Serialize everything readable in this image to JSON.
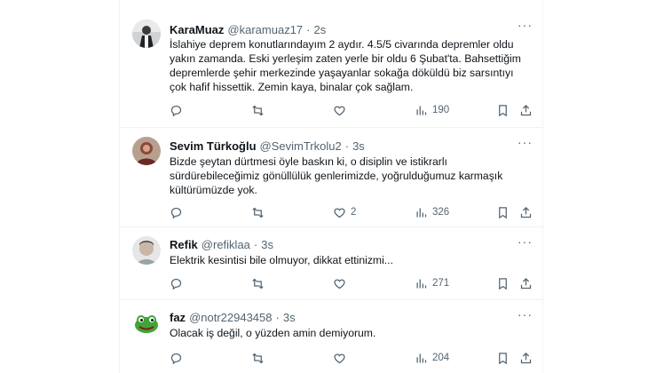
{
  "tweets": [
    {
      "name": "KaraMuaz",
      "handle": "@karamuaz17",
      "dot": "·",
      "time": "2s",
      "lines": [
        "İslahiye deprem konutlarındayım 2 aydır. 4.5/5 civarında depremler oldu",
        "yakın zamanda. Eski yerleşim zaten yerle bir oldu 6 Şubat'ta. Bahsettiğim",
        "depremlerde şehir merkezinde yaşayanlar sokağa döküldü biz sarsıntıyı",
        "çok hafif hissettik.  Zemin kaya, binalar çok sağlam."
      ],
      "likes": "",
      "views": "190"
    },
    {
      "name": "Sevim Türkoğlu",
      "handle": "@SevimTrkolu2",
      "dot": "·",
      "time": "3s",
      "lines": [
        "Bizde şeytan dürtmesi öyle baskın ki, o disiplin ve istikrarlı",
        "sürdürebileceğimiz gönüllülük genlerimizde, yoğrulduğumuz karmaşık",
        "kültürümüzde yok."
      ],
      "likes": "2",
      "views": "326"
    },
    {
      "name": "Refik",
      "handle": "@refiklaa",
      "dot": "·",
      "time": "3s",
      "lines": [
        "Elektrik kesintisi bile olmuyor, dikkat ettinizmi..."
      ],
      "likes": "",
      "views": "271"
    },
    {
      "name": "faz",
      "handle": "@notr22943458",
      "dot": "·",
      "time": "3s",
      "lines": [
        "Olacak iş değil, o yüzden amin demiyorum."
      ],
      "likes": "",
      "views": "204"
    }
  ],
  "more_glyph": "···",
  "icons": [
    "reply-icon",
    "retweet-icon",
    "like-icon",
    "views-icon",
    "bookmark-icon",
    "share-icon",
    "more-icon"
  ],
  "colors": {
    "text": "#0f1419",
    "secondary": "#536471",
    "divider": "#eff3f4"
  }
}
